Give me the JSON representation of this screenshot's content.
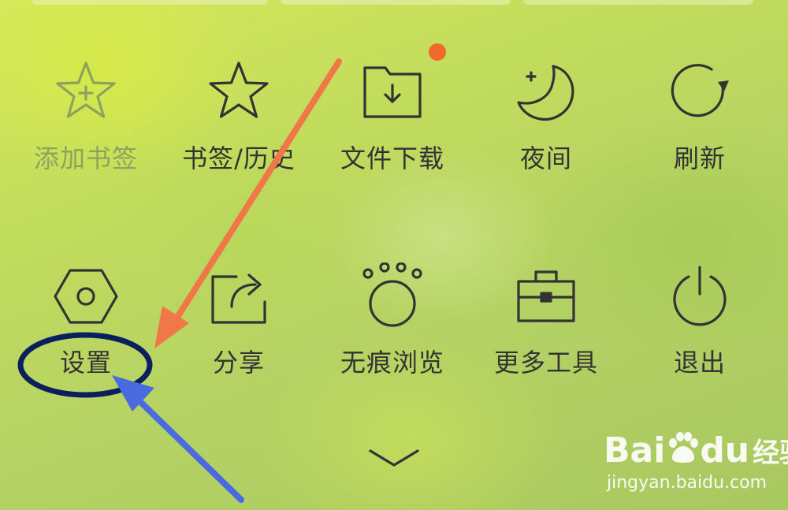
{
  "menu": {
    "row1": [
      {
        "label": "添加书签",
        "icon": "star-plus-icon",
        "enabled": false
      },
      {
        "label": "书签/历史",
        "icon": "star-icon",
        "enabled": true
      },
      {
        "label": "文件下载",
        "icon": "folder-download-icon",
        "enabled": true
      },
      {
        "label": "夜间",
        "icon": "moon-icon",
        "enabled": true
      },
      {
        "label": "刷新",
        "icon": "refresh-icon",
        "enabled": true
      }
    ],
    "row2": [
      {
        "label": "设置",
        "icon": "hex-nut-settings-icon",
        "enabled": true
      },
      {
        "label": "分享",
        "icon": "share-icon",
        "enabled": true
      },
      {
        "label": "无痕浏览",
        "icon": "paw-icon",
        "enabled": true
      },
      {
        "label": "更多工具",
        "icon": "toolbox-icon",
        "enabled": true
      },
      {
        "label": "退出",
        "icon": "power-icon",
        "enabled": true
      }
    ]
  },
  "collapse_icon": "chevron-down-icon",
  "colors": {
    "icon_stroke": "#333333",
    "disabled_stroke": "#8fa15e",
    "notification_dot": "#f06a2e",
    "arrow_orange": "#f07848",
    "arrow_blue": "#4a6be0",
    "circle_navy": "#0b1f5e"
  },
  "watermark": {
    "logo": "Bai",
    "logo2": "du",
    "cn": "经验",
    "url": "jingyan.baidu.com"
  }
}
